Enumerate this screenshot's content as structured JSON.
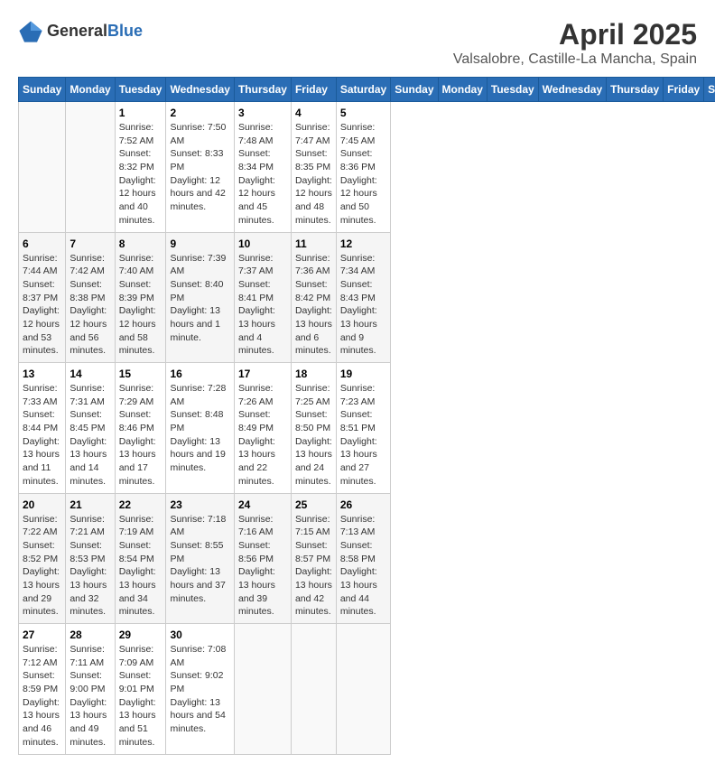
{
  "header": {
    "logo_general": "General",
    "logo_blue": "Blue",
    "title": "April 2025",
    "subtitle": "Valsalobre, Castille-La Mancha, Spain"
  },
  "calendar": {
    "days_of_week": [
      "Sunday",
      "Monday",
      "Tuesday",
      "Wednesday",
      "Thursday",
      "Friday",
      "Saturday"
    ],
    "weeks": [
      [
        {
          "day": "",
          "sunrise": "",
          "sunset": "",
          "daylight": ""
        },
        {
          "day": "",
          "sunrise": "",
          "sunset": "",
          "daylight": ""
        },
        {
          "day": "1",
          "sunrise": "Sunrise: 7:52 AM",
          "sunset": "Sunset: 8:32 PM",
          "daylight": "Daylight: 12 hours and 40 minutes."
        },
        {
          "day": "2",
          "sunrise": "Sunrise: 7:50 AM",
          "sunset": "Sunset: 8:33 PM",
          "daylight": "Daylight: 12 hours and 42 minutes."
        },
        {
          "day": "3",
          "sunrise": "Sunrise: 7:48 AM",
          "sunset": "Sunset: 8:34 PM",
          "daylight": "Daylight: 12 hours and 45 minutes."
        },
        {
          "day": "4",
          "sunrise": "Sunrise: 7:47 AM",
          "sunset": "Sunset: 8:35 PM",
          "daylight": "Daylight: 12 hours and 48 minutes."
        },
        {
          "day": "5",
          "sunrise": "Sunrise: 7:45 AM",
          "sunset": "Sunset: 8:36 PM",
          "daylight": "Daylight: 12 hours and 50 minutes."
        }
      ],
      [
        {
          "day": "6",
          "sunrise": "Sunrise: 7:44 AM",
          "sunset": "Sunset: 8:37 PM",
          "daylight": "Daylight: 12 hours and 53 minutes."
        },
        {
          "day": "7",
          "sunrise": "Sunrise: 7:42 AM",
          "sunset": "Sunset: 8:38 PM",
          "daylight": "Daylight: 12 hours and 56 minutes."
        },
        {
          "day": "8",
          "sunrise": "Sunrise: 7:40 AM",
          "sunset": "Sunset: 8:39 PM",
          "daylight": "Daylight: 12 hours and 58 minutes."
        },
        {
          "day": "9",
          "sunrise": "Sunrise: 7:39 AM",
          "sunset": "Sunset: 8:40 PM",
          "daylight": "Daylight: 13 hours and 1 minute."
        },
        {
          "day": "10",
          "sunrise": "Sunrise: 7:37 AM",
          "sunset": "Sunset: 8:41 PM",
          "daylight": "Daylight: 13 hours and 4 minutes."
        },
        {
          "day": "11",
          "sunrise": "Sunrise: 7:36 AM",
          "sunset": "Sunset: 8:42 PM",
          "daylight": "Daylight: 13 hours and 6 minutes."
        },
        {
          "day": "12",
          "sunrise": "Sunrise: 7:34 AM",
          "sunset": "Sunset: 8:43 PM",
          "daylight": "Daylight: 13 hours and 9 minutes."
        }
      ],
      [
        {
          "day": "13",
          "sunrise": "Sunrise: 7:33 AM",
          "sunset": "Sunset: 8:44 PM",
          "daylight": "Daylight: 13 hours and 11 minutes."
        },
        {
          "day": "14",
          "sunrise": "Sunrise: 7:31 AM",
          "sunset": "Sunset: 8:45 PM",
          "daylight": "Daylight: 13 hours and 14 minutes."
        },
        {
          "day": "15",
          "sunrise": "Sunrise: 7:29 AM",
          "sunset": "Sunset: 8:46 PM",
          "daylight": "Daylight: 13 hours and 17 minutes."
        },
        {
          "day": "16",
          "sunrise": "Sunrise: 7:28 AM",
          "sunset": "Sunset: 8:48 PM",
          "daylight": "Daylight: 13 hours and 19 minutes."
        },
        {
          "day": "17",
          "sunrise": "Sunrise: 7:26 AM",
          "sunset": "Sunset: 8:49 PM",
          "daylight": "Daylight: 13 hours and 22 minutes."
        },
        {
          "day": "18",
          "sunrise": "Sunrise: 7:25 AM",
          "sunset": "Sunset: 8:50 PM",
          "daylight": "Daylight: 13 hours and 24 minutes."
        },
        {
          "day": "19",
          "sunrise": "Sunrise: 7:23 AM",
          "sunset": "Sunset: 8:51 PM",
          "daylight": "Daylight: 13 hours and 27 minutes."
        }
      ],
      [
        {
          "day": "20",
          "sunrise": "Sunrise: 7:22 AM",
          "sunset": "Sunset: 8:52 PM",
          "daylight": "Daylight: 13 hours and 29 minutes."
        },
        {
          "day": "21",
          "sunrise": "Sunrise: 7:21 AM",
          "sunset": "Sunset: 8:53 PM",
          "daylight": "Daylight: 13 hours and 32 minutes."
        },
        {
          "day": "22",
          "sunrise": "Sunrise: 7:19 AM",
          "sunset": "Sunset: 8:54 PM",
          "daylight": "Daylight: 13 hours and 34 minutes."
        },
        {
          "day": "23",
          "sunrise": "Sunrise: 7:18 AM",
          "sunset": "Sunset: 8:55 PM",
          "daylight": "Daylight: 13 hours and 37 minutes."
        },
        {
          "day": "24",
          "sunrise": "Sunrise: 7:16 AM",
          "sunset": "Sunset: 8:56 PM",
          "daylight": "Daylight: 13 hours and 39 minutes."
        },
        {
          "day": "25",
          "sunrise": "Sunrise: 7:15 AM",
          "sunset": "Sunset: 8:57 PM",
          "daylight": "Daylight: 13 hours and 42 minutes."
        },
        {
          "day": "26",
          "sunrise": "Sunrise: 7:13 AM",
          "sunset": "Sunset: 8:58 PM",
          "daylight": "Daylight: 13 hours and 44 minutes."
        }
      ],
      [
        {
          "day": "27",
          "sunrise": "Sunrise: 7:12 AM",
          "sunset": "Sunset: 8:59 PM",
          "daylight": "Daylight: 13 hours and 46 minutes."
        },
        {
          "day": "28",
          "sunrise": "Sunrise: 7:11 AM",
          "sunset": "Sunset: 9:00 PM",
          "daylight": "Daylight: 13 hours and 49 minutes."
        },
        {
          "day": "29",
          "sunrise": "Sunrise: 7:09 AM",
          "sunset": "Sunset: 9:01 PM",
          "daylight": "Daylight: 13 hours and 51 minutes."
        },
        {
          "day": "30",
          "sunrise": "Sunrise: 7:08 AM",
          "sunset": "Sunset: 9:02 PM",
          "daylight": "Daylight: 13 hours and 54 minutes."
        },
        {
          "day": "",
          "sunrise": "",
          "sunset": "",
          "daylight": ""
        },
        {
          "day": "",
          "sunrise": "",
          "sunset": "",
          "daylight": ""
        },
        {
          "day": "",
          "sunrise": "",
          "sunset": "",
          "daylight": ""
        }
      ]
    ]
  }
}
